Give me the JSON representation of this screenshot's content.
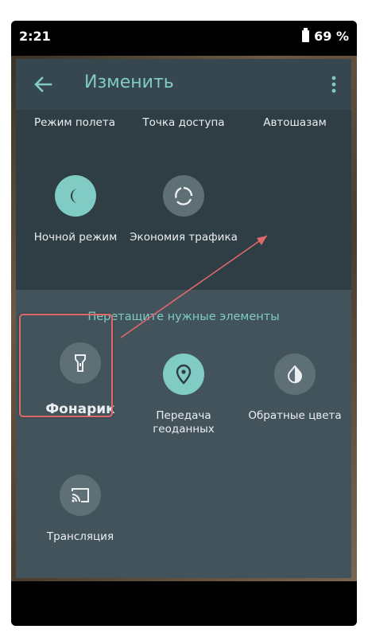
{
  "status": {
    "time": "2:21",
    "battery": "69 %"
  },
  "appbar": {
    "title": "Изменить"
  },
  "active_tiles": {
    "row1": [
      "Режим полета",
      "Точка доступа",
      "Автошазам"
    ],
    "night_mode": "Ночной режим",
    "data_saver": "Экономия трафика"
  },
  "available": {
    "heading": "Перетащите нужные элементы",
    "flashlight": "Фонарик",
    "location": "Передача геоданных",
    "invert_colors": "Обратные цвета",
    "cast": "Трансляция"
  },
  "colors": {
    "accent": "#80cbc4",
    "panel": "#37474f",
    "highlight": "#e0686b"
  },
  "icons": {
    "back": "arrow-left-icon",
    "menu": "more-vert-icon",
    "night_mode": "moon-icon",
    "data_saver": "data-saver-icon",
    "flashlight": "flashlight-icon",
    "location": "location-pin-icon",
    "invert_colors": "invert-colors-icon",
    "cast": "cast-icon"
  }
}
